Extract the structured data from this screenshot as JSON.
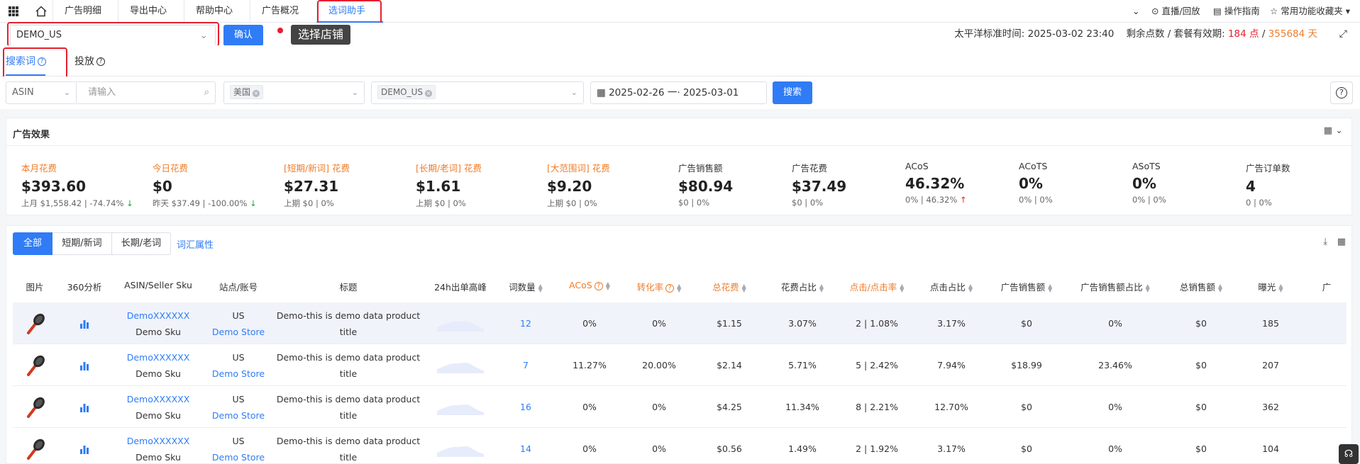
{
  "topbar": {
    "tabs": [
      "广告明细",
      "导出中心",
      "帮助中心",
      "广告概况",
      "选词助手"
    ],
    "active_tab": "选词助手",
    "tools": [
      "直播/回放",
      "操作指南",
      "常用功能收藏夹"
    ]
  },
  "store": {
    "selected": "DEMO_US",
    "confirm_label": "确认",
    "tooltip": "选择店铺"
  },
  "time_info": {
    "label": "太平洋标准时间:",
    "time": "2025-03-02 23:40",
    "points_label": "剩余点数 / 套餐有效期:",
    "points": "184 点",
    "sep": "/",
    "days": "355684 天"
  },
  "subtabs": [
    "搜索词",
    "投放"
  ],
  "filters": {
    "type": "ASIN",
    "placeholder": "请输入",
    "country": "美国",
    "store": "DEMO_US",
    "date_start": "2025-02-26",
    "date_sep": "一·",
    "date_end": "2025-03-01",
    "search_label": "搜索"
  },
  "ad_effect": {
    "title": "广告效果",
    "metrics": [
      {
        "title": "本月花费",
        "value": "$393.60",
        "sub": "上月 $1,558.42 | -74.74%",
        "trend": "↓",
        "trend_dir": "down",
        "highlight": true
      },
      {
        "title": "今日花费",
        "value": "$0",
        "sub": "昨天 $37.49 | -100.00%",
        "trend": "↓",
        "trend_dir": "down",
        "highlight": true
      },
      {
        "title": "[短期/新词] 花费",
        "value": "$27.31",
        "sub": "上期 $0 | 0%",
        "trend": "",
        "trend_dir": "",
        "highlight": true
      },
      {
        "title": "[长期/老词] 花费",
        "value": "$1.61",
        "sub": "上期 $0 | 0%",
        "trend": "",
        "trend_dir": "",
        "highlight": true
      },
      {
        "title": "[大范围词] 花费",
        "value": "$9.20",
        "sub": "上期 $0 | 0%",
        "trend": "",
        "trend_dir": "",
        "highlight": true
      },
      {
        "title": "广告销售额",
        "value": "$80.94",
        "sub": "$0 | 0%",
        "trend": "",
        "trend_dir": "",
        "highlight": false
      },
      {
        "title": "广告花费",
        "value": "$37.49",
        "sub": "$0 | 0%",
        "trend": "",
        "trend_dir": "",
        "highlight": false
      },
      {
        "title": "ACoS",
        "value": "46.32%",
        "sub": "0% | 46.32%",
        "trend": "↑",
        "trend_dir": "up",
        "highlight": false
      },
      {
        "title": "ACoTS",
        "value": "0%",
        "sub": "0% | 0%",
        "trend": "",
        "trend_dir": "",
        "highlight": false
      },
      {
        "title": "ASoTS",
        "value": "0%",
        "sub": "0% | 0%",
        "trend": "",
        "trend_dir": "",
        "highlight": false
      },
      {
        "title": "广告订单数",
        "value": "4",
        "sub": "0 | 0%",
        "trend": "",
        "trend_dir": "",
        "highlight": false
      }
    ]
  },
  "table": {
    "segments": [
      "全部",
      "短期/新词",
      "长期/老词"
    ],
    "vocab_link": "词汇属性",
    "headers": [
      "图片",
      "360分析",
      "ASIN/Seller Sku",
      "站点/账号",
      "标题",
      "24h出单高峰",
      "词数量",
      "ACoS",
      "转化率",
      "总花费",
      "花费占比",
      "点击/点击率",
      "点击占比",
      "广告销售额",
      "广告销售额占比",
      "总销售额",
      "曝光",
      "广"
    ],
    "rows": [
      {
        "asin": "DemoXXXXXX",
        "sku": "Demo Sku",
        "site": "US",
        "account": "Demo Store",
        "title1": "Demo-this is demo data product",
        "title2": "title",
        "words": "12",
        "acos": "0%",
        "cvr": "0%",
        "spend": "$1.15",
        "spend_pct": "3.07%",
        "clicks": "2 | 1.08%",
        "click_pct": "3.17%",
        "ad_sales": "$0",
        "ad_sales_pct": "0%",
        "total_sales": "$0",
        "impressions": "185"
      },
      {
        "asin": "DemoXXXXXX",
        "sku": "Demo Sku",
        "site": "US",
        "account": "Demo Store",
        "title1": "Demo-this is demo data product",
        "title2": "title",
        "words": "7",
        "acos": "11.27%",
        "cvr": "20.00%",
        "spend": "$2.14",
        "spend_pct": "5.71%",
        "clicks": "5 | 2.42%",
        "click_pct": "7.94%",
        "ad_sales": "$18.99",
        "ad_sales_pct": "23.46%",
        "total_sales": "$0",
        "impressions": "207"
      },
      {
        "asin": "DemoXXXXXX",
        "sku": "Demo Sku",
        "site": "US",
        "account": "Demo Store",
        "title1": "Demo-this is demo data product",
        "title2": "title",
        "words": "16",
        "acos": "0%",
        "cvr": "0%",
        "spend": "$4.25",
        "spend_pct": "11.34%",
        "clicks": "8 | 2.21%",
        "click_pct": "12.70%",
        "ad_sales": "$0",
        "ad_sales_pct": "0%",
        "total_sales": "$0",
        "impressions": "362"
      },
      {
        "asin": "DemoXXXXXX",
        "sku": "Demo Sku",
        "site": "US",
        "account": "Demo Store",
        "title1": "Demo-this is demo data product",
        "title2": "title",
        "words": "14",
        "acos": "0%",
        "cvr": "0%",
        "spend": "$0.56",
        "spend_pct": "1.49%",
        "clicks": "2 | 1.92%",
        "click_pct": "3.17%",
        "ad_sales": "$0",
        "ad_sales_pct": "0%",
        "total_sales": "$0",
        "impressions": "104"
      }
    ]
  },
  "colors": {
    "accent": "#2f7cf6",
    "orange": "#ee7d2b",
    "red": "#e5202e",
    "green": "#1aa34a"
  }
}
